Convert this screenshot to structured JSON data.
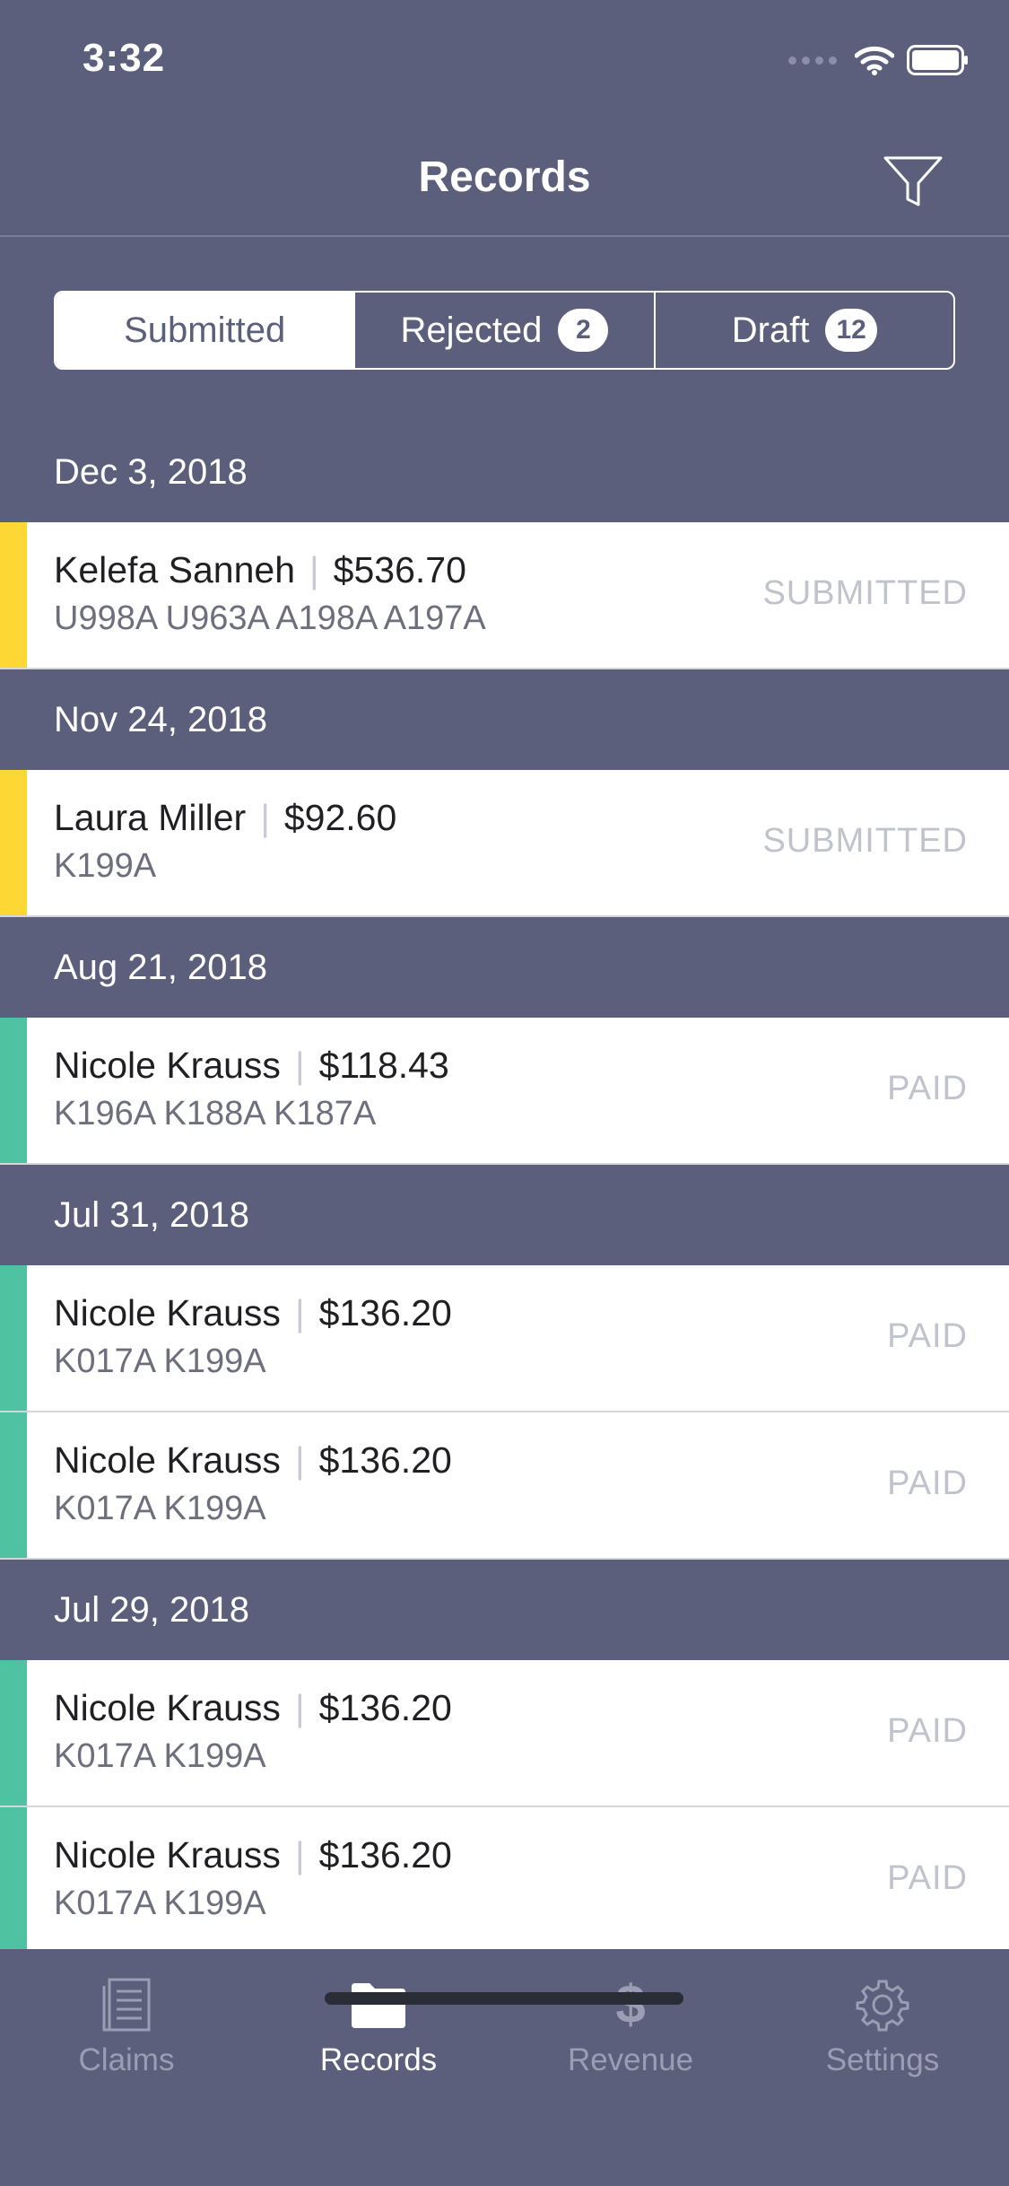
{
  "status_bar": {
    "time": "3:32"
  },
  "nav": {
    "title": "Records"
  },
  "segments": [
    {
      "label": "Submitted",
      "badge": null,
      "active": true
    },
    {
      "label": "Rejected",
      "badge": "2",
      "active": false
    },
    {
      "label": "Draft",
      "badge": "12",
      "active": false
    }
  ],
  "colors": {
    "background": "#5c5f7b",
    "submitted_bar": "#fdd835",
    "paid_bar": "#4fc3a1",
    "status_text": "#c0c3cc"
  },
  "sections": [
    {
      "date": "Dec 3, 2018",
      "records": [
        {
          "name": "Kelefa Sanneh",
          "amount": "$536.70",
          "codes": "U998A U963A A198A A197A",
          "status": "SUBMITTED"
        }
      ]
    },
    {
      "date": "Nov 24, 2018",
      "records": [
        {
          "name": "Laura Miller",
          "amount": "$92.60",
          "codes": "K199A",
          "status": "SUBMITTED"
        }
      ]
    },
    {
      "date": "Aug 21, 2018",
      "records": [
        {
          "name": "Nicole Krauss",
          "amount": "$118.43",
          "codes": "K196A K188A K187A",
          "status": "PAID"
        }
      ]
    },
    {
      "date": "Jul 31, 2018",
      "records": [
        {
          "name": "Nicole Krauss",
          "amount": "$136.20",
          "codes": "K017A K199A",
          "status": "PAID"
        },
        {
          "name": "Nicole Krauss",
          "amount": "$136.20",
          "codes": "K017A K199A",
          "status": "PAID"
        }
      ]
    },
    {
      "date": "Jul 29, 2018",
      "records": [
        {
          "name": "Nicole Krauss",
          "amount": "$136.20",
          "codes": "K017A K199A",
          "status": "PAID"
        },
        {
          "name": "Nicole Krauss",
          "amount": "$136.20",
          "codes": "K017A K199A",
          "status": "PAID"
        }
      ]
    }
  ],
  "tabs": [
    {
      "label": "Claims",
      "icon": "document-icon",
      "active": false
    },
    {
      "label": "Records",
      "icon": "folder-icon",
      "active": true
    },
    {
      "label": "Revenue",
      "icon": "dollar-icon",
      "active": false
    },
    {
      "label": "Settings",
      "icon": "gear-icon",
      "active": false
    }
  ]
}
